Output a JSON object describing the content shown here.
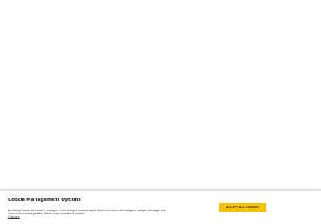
{
  "cookie_banner": {
    "title": "Cookie Management Options",
    "text_line1": "By clicking “Accept All Cookies”, you agree to the storing of cookies on your device to enhance site",
    "text_line2": "navigation, analyze site usage, and assist in our marketing efforts. Want to learn more about cookies?",
    "link_label": "Click here",
    "accept_label": "ACCEPT ALL COOKIES",
    "accent_color": "#f5c400"
  }
}
